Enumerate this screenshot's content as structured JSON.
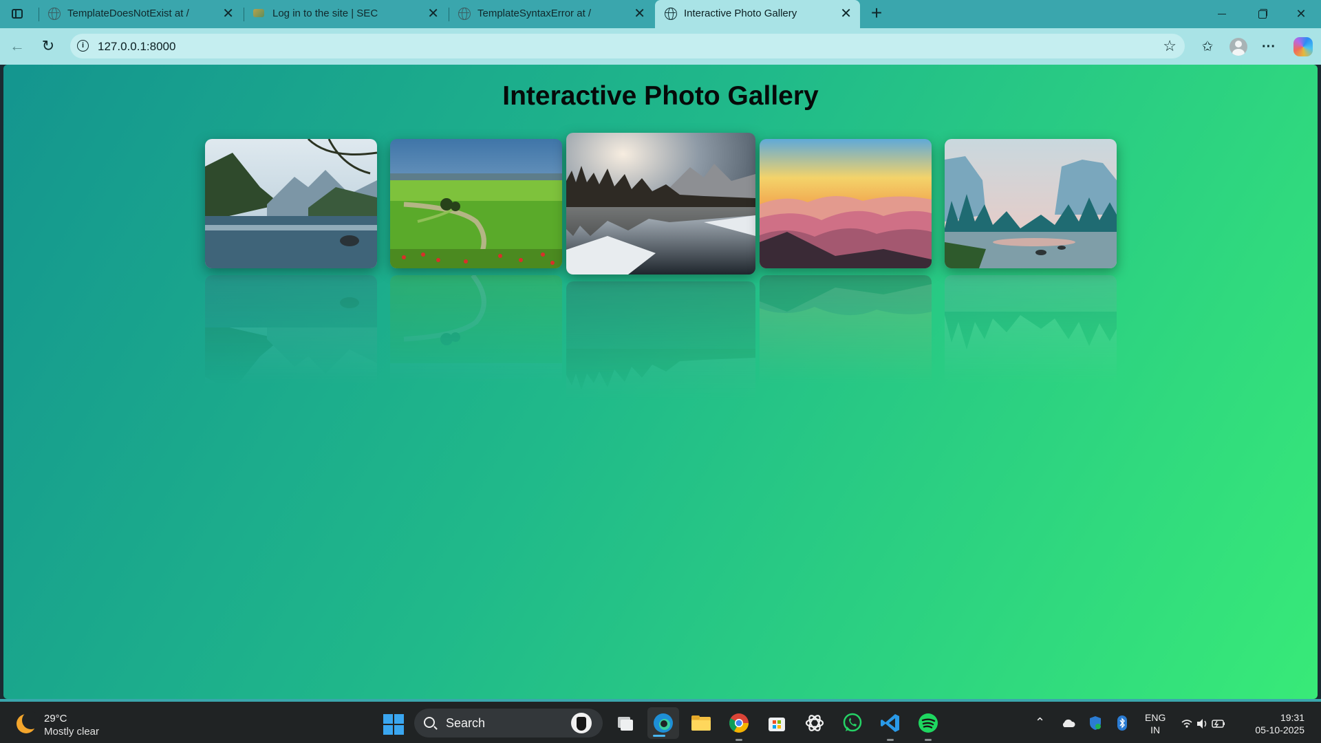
{
  "browser": {
    "tabs": [
      {
        "title": "TemplateDoesNotExist at /",
        "favicon": "globe-icon"
      },
      {
        "title": "Log in to the site | SEC",
        "favicon": "sec-favicon"
      },
      {
        "title": "TemplateSyntaxError at /",
        "favicon": "globe-icon"
      },
      {
        "title": "Interactive Photo Gallery",
        "favicon": "globe-icon",
        "active": true
      }
    ],
    "tab_close_glyph": "✕",
    "new_tab_glyph": "+",
    "url": "127.0.0.1:8000",
    "info_glyph": "i",
    "star_glyph": "☆",
    "favorites_glyph": "✩",
    "more_glyph": "···",
    "back_glyph": "←",
    "reload_glyph": "↻",
    "close_window_glyph": "✕"
  },
  "page": {
    "title": "Interactive Photo Gallery",
    "background_colors": [
      "#14958f",
      "#38ea78"
    ],
    "photos": [
      {
        "subject": "mountain lake with tree branches"
      },
      {
        "subject": "green meadow with winding path and red flowers"
      },
      {
        "subject": "snowy lake reflecting pine forest and peaks at sunrise",
        "hovered": true
      },
      {
        "subject": "layered mountain ridges at colorful sunset"
      },
      {
        "subject": "misty valley river with blue pine trees"
      }
    ]
  },
  "taskbar": {
    "weather": {
      "temp": "29°C",
      "condition": "Mostly clear"
    },
    "search_label": "Search",
    "language": {
      "line1": "ENG",
      "line2": "IN"
    },
    "clock": {
      "time": "19:31",
      "date": "05-10-2025"
    },
    "tray_expand_glyph": "⌃",
    "accent": "#3aa6ad"
  }
}
